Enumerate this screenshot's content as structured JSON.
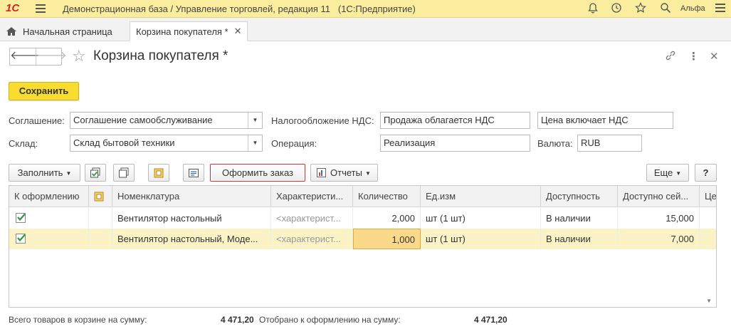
{
  "app": {
    "logo": "1С",
    "title": "Демонстрационная база / Управление торговлей, редакция 11",
    "platform": "(1С:Предприятие)",
    "user": "Альфа"
  },
  "tabs": [
    {
      "label": "Начальная страница"
    },
    {
      "label": "Корзина покупателя *"
    }
  ],
  "form": {
    "title": "Корзина покупателя *",
    "save_label": "Сохранить"
  },
  "fields": {
    "agreement_label": "Соглашение:",
    "agreement_value": "Соглашение самообслуживание",
    "warehouse_label": "Склад:",
    "warehouse_value": "Склад бытовой техники",
    "vat_label": "Налогообложение НДС:",
    "vat_value": "Продажа облагается НДС",
    "price_vat_value": "Цена включает НДС",
    "operation_label": "Операция:",
    "operation_value": "Реализация",
    "currency_label": "Валюта:",
    "currency_value": "RUB"
  },
  "toolbar": {
    "fill_label": "Заполнить",
    "place_order_label": "Оформить заказ",
    "reports_label": "Отчеты",
    "more_label": "Еще",
    "help_label": "?"
  },
  "table": {
    "columns": [
      "К оформлению",
      "",
      "Номенклатура",
      "Характеристи...",
      "Количество",
      "Ед.изм",
      "Доступность",
      "Доступно сей...",
      "Це"
    ],
    "rows": [
      {
        "name": "Вентилятор настольный",
        "characteristic": "<характерист...",
        "quantity": "2,000",
        "unit": "шт (1 шт)",
        "availability": "В наличии",
        "available_now": "15,000"
      },
      {
        "name": "Вентилятор настольный, Моде...",
        "characteristic": "<характерист...",
        "quantity": "1,000",
        "unit": "шт (1 шт)",
        "availability": "В наличии",
        "available_now": "7,000"
      }
    ]
  },
  "footer": {
    "total_label": "Всего товаров в корзине на сумму:",
    "total_value": "4 471,20",
    "selected_label": "Отобрано к оформлению на сумму:",
    "selected_value": "4 471,20"
  }
}
